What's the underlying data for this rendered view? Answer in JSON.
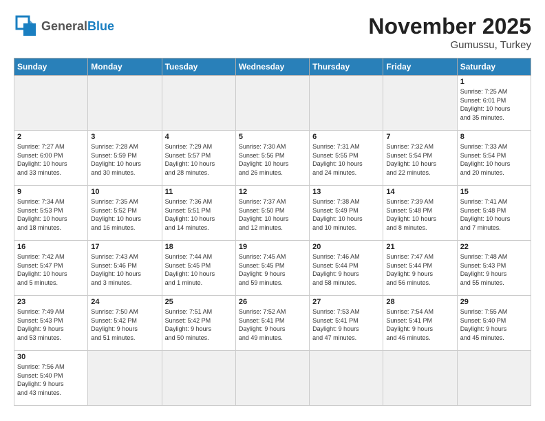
{
  "header": {
    "logo_general": "General",
    "logo_blue": "Blue",
    "month_title": "November 2025",
    "location": "Gumussu, Turkey"
  },
  "weekdays": [
    "Sunday",
    "Monday",
    "Tuesday",
    "Wednesday",
    "Thursday",
    "Friday",
    "Saturday"
  ],
  "days": [
    {
      "num": "",
      "info": ""
    },
    {
      "num": "",
      "info": ""
    },
    {
      "num": "",
      "info": ""
    },
    {
      "num": "",
      "info": ""
    },
    {
      "num": "",
      "info": ""
    },
    {
      "num": "",
      "info": ""
    },
    {
      "num": "1",
      "info": "Sunrise: 7:25 AM\nSunset: 6:01 PM\nDaylight: 10 hours\nand 35 minutes."
    },
    {
      "num": "2",
      "info": "Sunrise: 7:27 AM\nSunset: 6:00 PM\nDaylight: 10 hours\nand 33 minutes."
    },
    {
      "num": "3",
      "info": "Sunrise: 7:28 AM\nSunset: 5:59 PM\nDaylight: 10 hours\nand 30 minutes."
    },
    {
      "num": "4",
      "info": "Sunrise: 7:29 AM\nSunset: 5:57 PM\nDaylight: 10 hours\nand 28 minutes."
    },
    {
      "num": "5",
      "info": "Sunrise: 7:30 AM\nSunset: 5:56 PM\nDaylight: 10 hours\nand 26 minutes."
    },
    {
      "num": "6",
      "info": "Sunrise: 7:31 AM\nSunset: 5:55 PM\nDaylight: 10 hours\nand 24 minutes."
    },
    {
      "num": "7",
      "info": "Sunrise: 7:32 AM\nSunset: 5:54 PM\nDaylight: 10 hours\nand 22 minutes."
    },
    {
      "num": "8",
      "info": "Sunrise: 7:33 AM\nSunset: 5:54 PM\nDaylight: 10 hours\nand 20 minutes."
    },
    {
      "num": "9",
      "info": "Sunrise: 7:34 AM\nSunset: 5:53 PM\nDaylight: 10 hours\nand 18 minutes."
    },
    {
      "num": "10",
      "info": "Sunrise: 7:35 AM\nSunset: 5:52 PM\nDaylight: 10 hours\nand 16 minutes."
    },
    {
      "num": "11",
      "info": "Sunrise: 7:36 AM\nSunset: 5:51 PM\nDaylight: 10 hours\nand 14 minutes."
    },
    {
      "num": "12",
      "info": "Sunrise: 7:37 AM\nSunset: 5:50 PM\nDaylight: 10 hours\nand 12 minutes."
    },
    {
      "num": "13",
      "info": "Sunrise: 7:38 AM\nSunset: 5:49 PM\nDaylight: 10 hours\nand 10 minutes."
    },
    {
      "num": "14",
      "info": "Sunrise: 7:39 AM\nSunset: 5:48 PM\nDaylight: 10 hours\nand 8 minutes."
    },
    {
      "num": "15",
      "info": "Sunrise: 7:41 AM\nSunset: 5:48 PM\nDaylight: 10 hours\nand 7 minutes."
    },
    {
      "num": "16",
      "info": "Sunrise: 7:42 AM\nSunset: 5:47 PM\nDaylight: 10 hours\nand 5 minutes."
    },
    {
      "num": "17",
      "info": "Sunrise: 7:43 AM\nSunset: 5:46 PM\nDaylight: 10 hours\nand 3 minutes."
    },
    {
      "num": "18",
      "info": "Sunrise: 7:44 AM\nSunset: 5:45 PM\nDaylight: 10 hours\nand 1 minute."
    },
    {
      "num": "19",
      "info": "Sunrise: 7:45 AM\nSunset: 5:45 PM\nDaylight: 9 hours\nand 59 minutes."
    },
    {
      "num": "20",
      "info": "Sunrise: 7:46 AM\nSunset: 5:44 PM\nDaylight: 9 hours\nand 58 minutes."
    },
    {
      "num": "21",
      "info": "Sunrise: 7:47 AM\nSunset: 5:44 PM\nDaylight: 9 hours\nand 56 minutes."
    },
    {
      "num": "22",
      "info": "Sunrise: 7:48 AM\nSunset: 5:43 PM\nDaylight: 9 hours\nand 55 minutes."
    },
    {
      "num": "23",
      "info": "Sunrise: 7:49 AM\nSunset: 5:43 PM\nDaylight: 9 hours\nand 53 minutes."
    },
    {
      "num": "24",
      "info": "Sunrise: 7:50 AM\nSunset: 5:42 PM\nDaylight: 9 hours\nand 51 minutes."
    },
    {
      "num": "25",
      "info": "Sunrise: 7:51 AM\nSunset: 5:42 PM\nDaylight: 9 hours\nand 50 minutes."
    },
    {
      "num": "26",
      "info": "Sunrise: 7:52 AM\nSunset: 5:41 PM\nDaylight: 9 hours\nand 49 minutes."
    },
    {
      "num": "27",
      "info": "Sunrise: 7:53 AM\nSunset: 5:41 PM\nDaylight: 9 hours\nand 47 minutes."
    },
    {
      "num": "28",
      "info": "Sunrise: 7:54 AM\nSunset: 5:41 PM\nDaylight: 9 hours\nand 46 minutes."
    },
    {
      "num": "29",
      "info": "Sunrise: 7:55 AM\nSunset: 5:40 PM\nDaylight: 9 hours\nand 45 minutes."
    },
    {
      "num": "30",
      "info": "Sunrise: 7:56 AM\nSunset: 5:40 PM\nDaylight: 9 hours\nand 43 minutes."
    },
    {
      "num": "",
      "info": ""
    },
    {
      "num": "",
      "info": ""
    },
    {
      "num": "",
      "info": ""
    },
    {
      "num": "",
      "info": ""
    },
    {
      "num": "",
      "info": ""
    }
  ]
}
